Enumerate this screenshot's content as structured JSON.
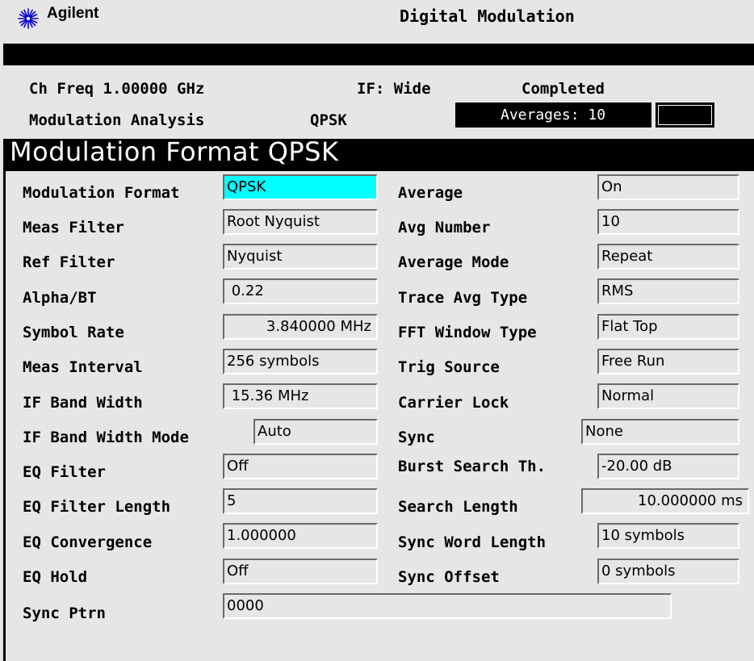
{
  "header": {
    "brand": "Agilent",
    "title": "Digital Modulation"
  },
  "status": {
    "ch_freq": "Ch Freq 1.00000 GHz",
    "if_mode": "IF: Wide",
    "meas_status": "Completed",
    "measurement": "Modulation Analysis",
    "format": "QPSK",
    "averages": "Averages: 10"
  },
  "banner": "Modulation Format QPSK",
  "left_fields": [
    {
      "label": "Modulation Format",
      "value": "QPSK",
      "selected": true
    },
    {
      "label": "Meas Filter",
      "value": "Root Nyquist"
    },
    {
      "label": "Ref Filter",
      "value": "Nyquist"
    },
    {
      "label": "Alpha/BT",
      "value": " 0.22"
    },
    {
      "label": "Symbol Rate",
      "value": "3.840000 MHz"
    },
    {
      "label": "Meas Interval",
      "value": "256 symbols"
    },
    {
      "label": "IF Band Width",
      "value": " 15.36 MHz"
    },
    {
      "label": "IF Band Width Mode",
      "value": "Auto"
    },
    {
      "label": "EQ Filter",
      "value": "Off"
    },
    {
      "label": "EQ Filter Length",
      "value": "5"
    },
    {
      "label": "EQ Convergence",
      "value": "1.000000"
    },
    {
      "label": "EQ Hold",
      "value": "Off"
    },
    {
      "label": "Sync Ptrn",
      "value": "0000"
    }
  ],
  "right_fields": [
    {
      "label": "Average",
      "value": "On"
    },
    {
      "label": "Avg Number",
      "value": "10"
    },
    {
      "label": "Average Mode",
      "value": "Repeat"
    },
    {
      "label": "Trace Avg Type",
      "value": "RMS"
    },
    {
      "label": "FFT Window Type",
      "value": "Flat Top"
    },
    {
      "label": "Trig Source",
      "value": "Free Run"
    },
    {
      "label": "Carrier Lock",
      "value": "Normal"
    },
    {
      "label": "Sync",
      "value": "None"
    },
    {
      "label": "Burst Search Th.",
      "value": "-20.00 dB"
    },
    {
      "label": "Search Length",
      "value": "10.000000 ms"
    },
    {
      "label": "Sync Word Length",
      "value": "10 symbols"
    },
    {
      "label": "Sync Offset",
      "value": "0 symbols"
    }
  ],
  "colors": {
    "background": "#e6e6e6",
    "selected_field": "#00ffff",
    "logo": "#0000cc"
  },
  "icons": {
    "logo": "agilent-spark-icon"
  }
}
